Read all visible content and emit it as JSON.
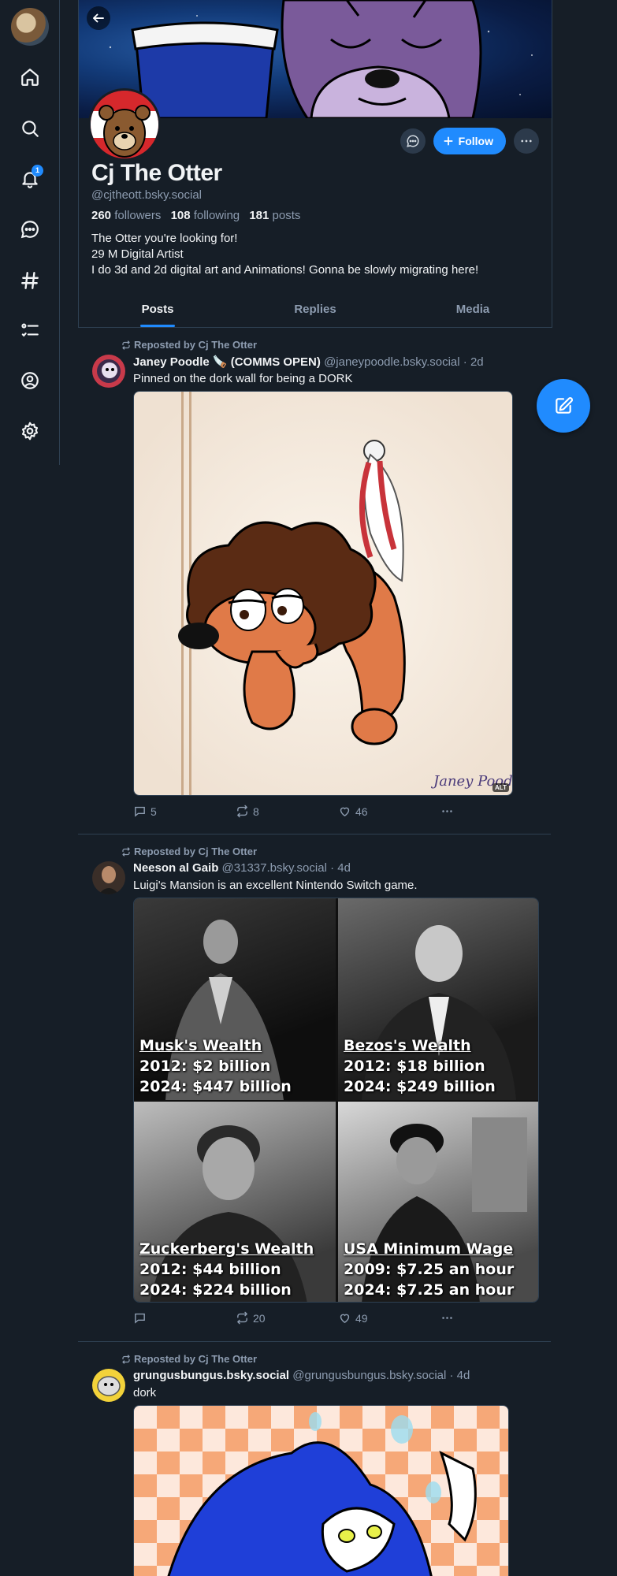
{
  "nav": {
    "notification_count": "1",
    "items": [
      "home-icon",
      "search-icon",
      "bell-icon",
      "chat-icon",
      "hashtag-icon",
      "list-icon",
      "profile-icon",
      "gear-icon"
    ]
  },
  "profile": {
    "display_name": "Cj The Otter",
    "handle": "@cjtheott.bsky.social",
    "followers_count": "260",
    "followers_label": "followers",
    "following_count": "108",
    "following_label": "following",
    "posts_count": "181",
    "posts_label": "posts",
    "bio_lines": [
      "The Otter you're looking for!",
      "29 M Digital Artist",
      "I do 3d and 2d digital art and Animations! Gonna be slowly migrating here!"
    ],
    "follow_label": "Follow"
  },
  "tabs": [
    {
      "label": "Posts",
      "active": true
    },
    {
      "label": "Replies",
      "active": false
    },
    {
      "label": "Media",
      "active": false
    }
  ],
  "colors": {
    "background": "#161e27",
    "accent": "#208bfe",
    "muted_text": "#8d9cb0",
    "border": "#2e4052"
  },
  "posts": [
    {
      "repost_label": "Reposted by Cj The Otter",
      "author_name": "Janey Poodle 🪚 (COMMS OPEN)",
      "author_handle": "@janeypoodle.bsky.social",
      "time": "· 2d",
      "text": "Pinned on the dork wall for being a DORK",
      "image_signature": "Janey Poodle",
      "alt_badge": "ALT",
      "replies": "5",
      "reposts": "8",
      "likes": "46"
    },
    {
      "repost_label": "Reposted by Cj The Otter",
      "author_name": "Neeson al Gaib",
      "author_handle": "@31337.bsky.social",
      "time": "· 4d",
      "text": "Luigi's Mansion is an excellent Nintendo Switch game.",
      "meme_panels": [
        {
          "title": "Musk's Wealth",
          "line1": "2012: $2 billion",
          "line2": "2024: $447 billion"
        },
        {
          "title": "Bezos's Wealth",
          "line1": "2012: $18 billion",
          "line2": "2024: $249 billion"
        },
        {
          "title": "Zuckerberg's Wealth",
          "line1": "2012: $44 billion",
          "line2": "2024: $224 billion"
        },
        {
          "title": "USA Minimum Wage",
          "line1": "2009: $7.25 an hour",
          "line2": "2024: $7.25 an hour"
        }
      ],
      "replies": "",
      "reposts": "20",
      "likes": "49"
    },
    {
      "repost_label": "Reposted by Cj The Otter",
      "author_name": "grungusbungus.bsky.social",
      "author_handle": "@grungusbungus.bsky.social",
      "time": "· 4d",
      "text": "dork"
    }
  ]
}
